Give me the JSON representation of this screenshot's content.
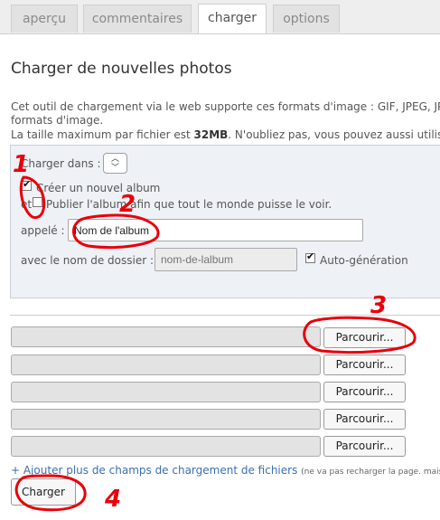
{
  "tabs": [
    {
      "label": "aperçu"
    },
    {
      "label": "commentaires"
    },
    {
      "label": "charger"
    },
    {
      "label": "options"
    }
  ],
  "page_title": "Charger de nouvelles photos",
  "description": {
    "line1": "Cet outil de chargement via le web supporte ces formats d'image : GIF, JPEG, JP",
    "line2": "formats d'image.",
    "line3_prefix": "La taille maximum par fichier est ",
    "line3_size": "32MB",
    "line3_suffix": ". N'oubliez pas, vous pouvez aussi utiliser"
  },
  "form": {
    "charger_dans_label": "Charger dans :",
    "creer_album_label": "Créer un nouvel album",
    "creer_album_checked": true,
    "et_label": "et",
    "publier_label": "Publier l'album afin que tout le monde puisse le voir.",
    "publier_checked": false,
    "appele_label": "appelé :",
    "album_name_value": "Nom de l'album",
    "dossier_label": "avec le nom de dossier :",
    "dossier_placeholder": "nom-de-lalbum",
    "autogen_label": "Auto-génération",
    "autogen_checked": true
  },
  "upload": {
    "browse_label": "Parcourir...",
    "add_more_link": "+ Ajouter plus de champs de chargement de fichiers",
    "add_more_note": "(ne va pas recharger la page. mais s",
    "submit_label": "Charger"
  },
  "annotations": [
    "1",
    "2",
    "3",
    "4"
  ],
  "colors": {
    "annotation": "#e8000a",
    "link": "#3a6fb0"
  }
}
